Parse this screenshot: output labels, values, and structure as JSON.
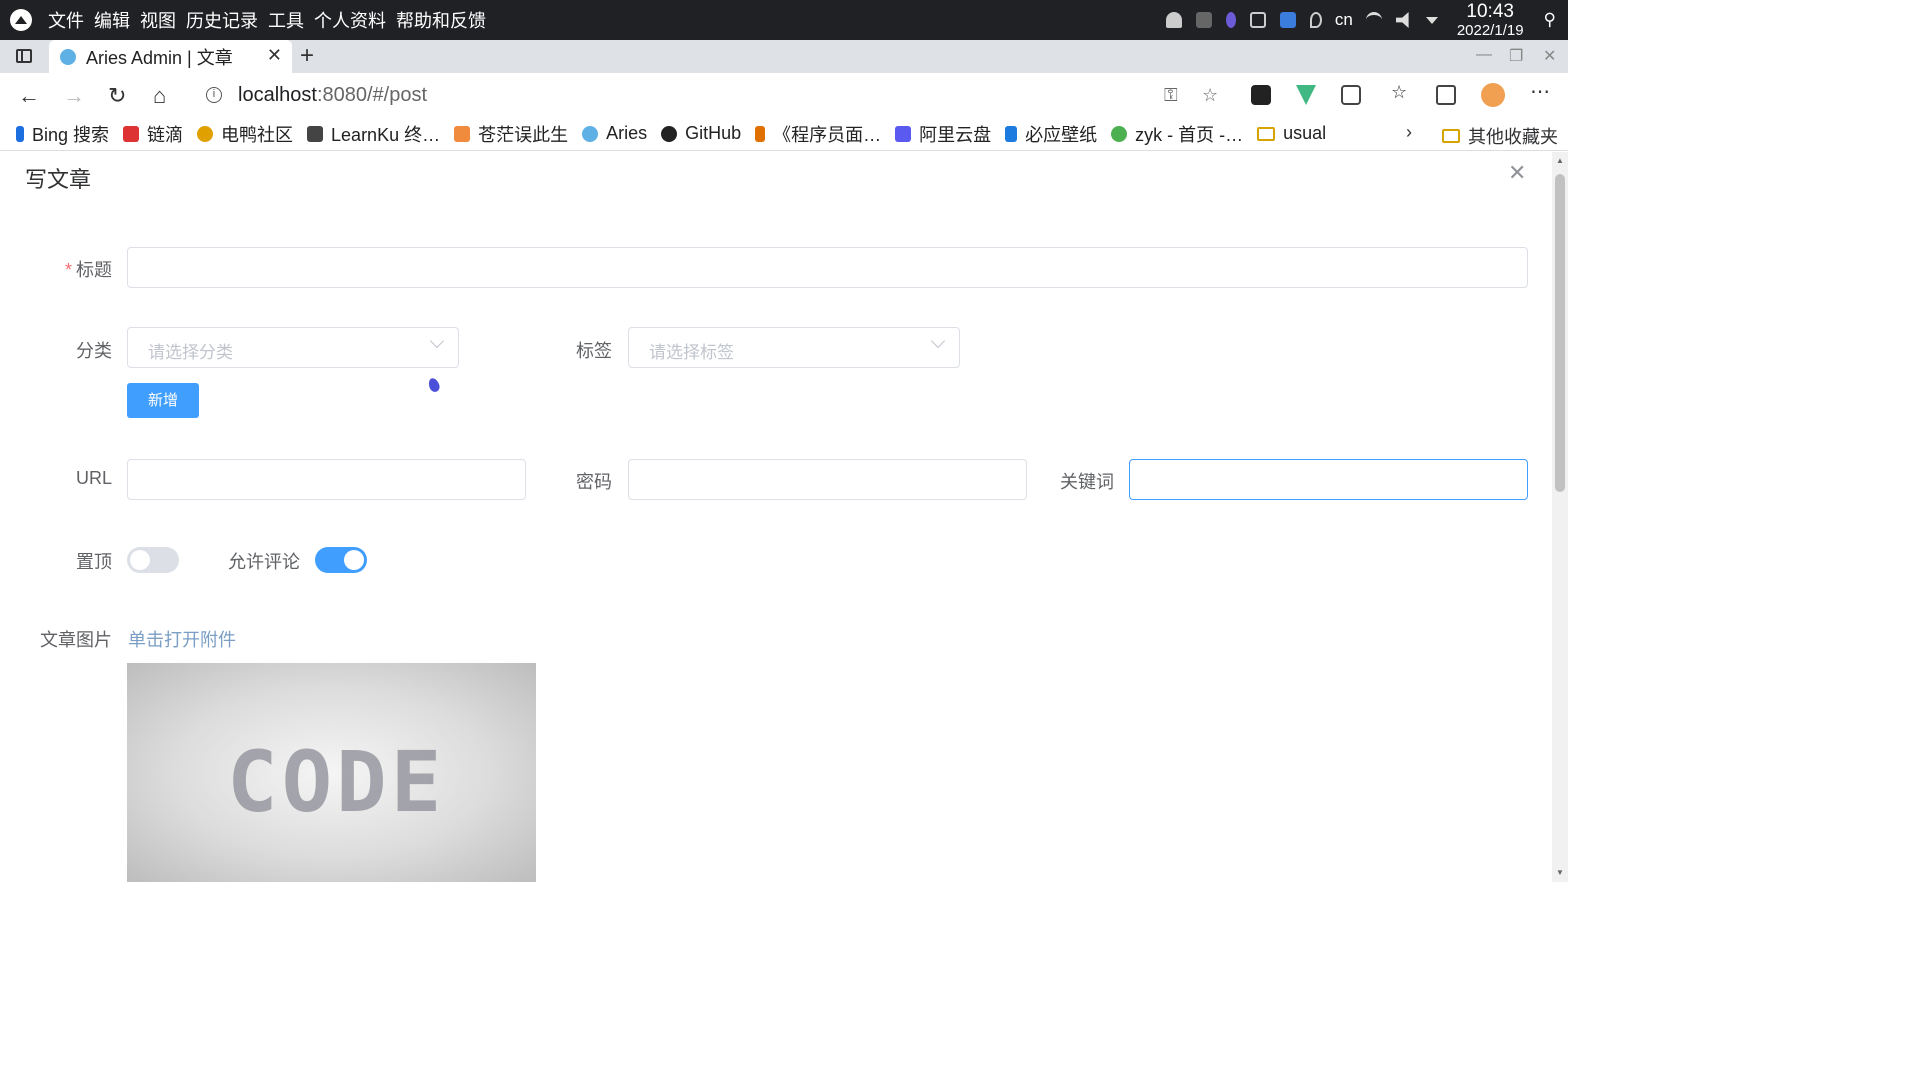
{
  "os": {
    "menu": [
      "文件",
      "编辑",
      "视图",
      "历史记录",
      "工具",
      "个人资料",
      "帮助和反馈"
    ],
    "tray_lang": "cn",
    "clock_time": "10:43",
    "clock_date": "2022/1/19"
  },
  "browser": {
    "tab_title": "Aries Admin | 文章",
    "url_host": "localhost",
    "url_rest": ":8080/#/post",
    "bookmarks": [
      {
        "label": "Bing 搜索",
        "color": "#1d6fe0"
      },
      {
        "label": "链滴",
        "color": "#d33"
      },
      {
        "label": "电鸭社区",
        "color": "#e0a000"
      },
      {
        "label": "LearnKu 终…",
        "color": "#444"
      },
      {
        "label": "苍茫误此生",
        "color": "#f08a3c"
      },
      {
        "label": "Aries",
        "color": "#5fb0e5"
      },
      {
        "label": "GitHub",
        "color": "#222"
      },
      {
        "label": "《程序员面…",
        "color": "#e07000"
      },
      {
        "label": "阿里云盘",
        "color": "#5a5af0"
      },
      {
        "label": "必应壁纸",
        "color": "#1d7be0"
      },
      {
        "label": "zyk - 首页 -…",
        "color": "#4caf50"
      },
      {
        "label": "usual",
        "color": "#d6a400"
      }
    ],
    "other_bookmarks": "其他收藏夹"
  },
  "form": {
    "dialog_title": "写文章",
    "title_label": "标题",
    "title_value": "",
    "category_label": "分类",
    "category_placeholder": "请选择分类",
    "tag_label": "标签",
    "tag_placeholder": "请选择标签",
    "add_button": "新增",
    "url_label": "URL",
    "url_value": "",
    "password_label": "密码",
    "password_value": "",
    "keywords_label": "关键词",
    "keywords_value": "",
    "pin_label": "置顶",
    "pin_on": false,
    "comment_label": "允许评论",
    "comment_on": true,
    "image_label": "文章图片",
    "image_link": "单击打开附件",
    "image_text": "CODE"
  },
  "colors": {
    "primary": "#409eff",
    "required": "#f56c6c"
  }
}
